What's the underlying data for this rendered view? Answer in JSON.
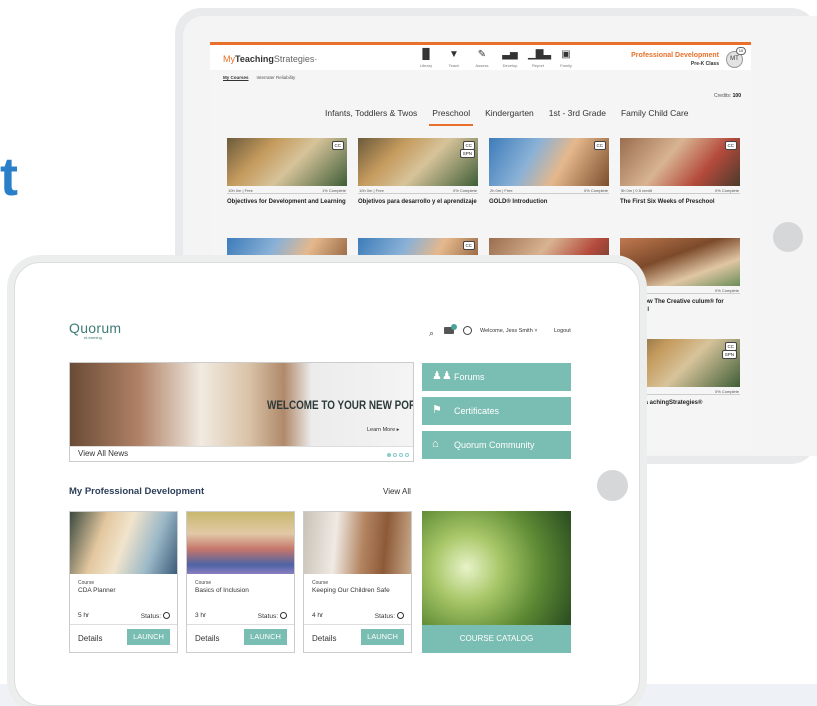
{
  "partial_text": "t",
  "back_app": {
    "logo_my": "My",
    "logo_teaching": "Teaching",
    "logo_strategies": "Strategies",
    "logo_mark": "·",
    "nav": [
      {
        "label": "Library",
        "glyph": "▐▌"
      },
      {
        "label": "Teach",
        "glyph": "▼"
      },
      {
        "label": "Assess",
        "glyph": "✎"
      },
      {
        "label": "Develop",
        "glyph": "▃▅"
      },
      {
        "label": "Report",
        "glyph": "▁▇▃"
      },
      {
        "label": "Family",
        "glyph": "▣"
      }
    ],
    "profile_title": "Professional Development",
    "profile_sub": "Pre-K Class",
    "avatar_initials": "MT",
    "badge_count": "10",
    "subnav_active": "My Courses",
    "subnav_other": "Interrater Reliability",
    "credits_label": "Credits:",
    "credits_value": "100",
    "tabs": [
      "Infants, Toddlers & Twos",
      "Preschool",
      "Kindergarten",
      "1st - 3rd Grade",
      "Family Child Care"
    ],
    "active_tab": "Preschool",
    "cards": [
      {
        "meta_left": "10h 0m | Free",
        "meta_right": "1% Complete",
        "title": "Objectives for Development and Learning",
        "cc": "CC",
        "spn": ""
      },
      {
        "meta_left": "10h 0m | Free",
        "meta_right": "0% Complete",
        "title": "Objetivos para desarrollo y el aprendizaje",
        "cc": "CC",
        "spn": "SPN"
      },
      {
        "meta_left": "2h 0m | Free",
        "meta_right": "0% Complete",
        "title": "GOLD® Introduction",
        "cc": "CC",
        "spn": ""
      },
      {
        "meta_left": "5h 0m | 0.5 credit",
        "meta_right": "0% Complete",
        "title": "The First Six Weeks of Preschool",
        "cc": "CC",
        "spn": ""
      }
    ],
    "row2_cards": [
      {
        "meta_left": "Free",
        "meta_right": "0% Complete",
        "title": "ng to Know The Creative culum® for Preschool",
        "cc": "",
        "spn": ""
      },
      {
        "meta_left": "Free",
        "meta_right": "0% Complete",
        "title": "ducción a achingStrategies®",
        "cc": "CC",
        "spn": "SPN"
      }
    ],
    "row2_cc": "CC",
    "accent_color": "#e8702a"
  },
  "front_app": {
    "logo": "Quorum",
    "logo_sub": "eLearning",
    "search_icon": "⌕",
    "welcome": "Welcome, Jess Smith",
    "welcome_caret": "˅",
    "logout": "Logout",
    "hero_title": "WELCOME TO YOUR NEW PORTAL",
    "hero_link": "Learn More ▸",
    "view_all_news": "View All News",
    "side_buttons": [
      {
        "label": "Forums",
        "icon": "♟♟"
      },
      {
        "label": "Certificates",
        "icon": "⚑"
      },
      {
        "label": "Quorum Community",
        "icon": "⌂"
      }
    ],
    "section_title": "My Professional Development",
    "view_all": "View All",
    "courses": [
      {
        "type": "Course",
        "title": "CDA Planner",
        "hours": "5 hr",
        "status": "Status:",
        "details": "Details",
        "launch": "LAUNCH"
      },
      {
        "type": "Course",
        "title": "Basics of Inclusion",
        "hours": "3 hr",
        "status": "Status:",
        "details": "Details",
        "launch": "LAUNCH"
      },
      {
        "type": "Course",
        "title": "Keeping Our Children Safe",
        "hours": "4 hr",
        "status": "Status:",
        "details": "Details",
        "launch": "LAUNCH"
      }
    ],
    "catalog": "COURSE CATALOG",
    "accent_color": "#7abdb2",
    "logo_color": "#3e7a76"
  }
}
